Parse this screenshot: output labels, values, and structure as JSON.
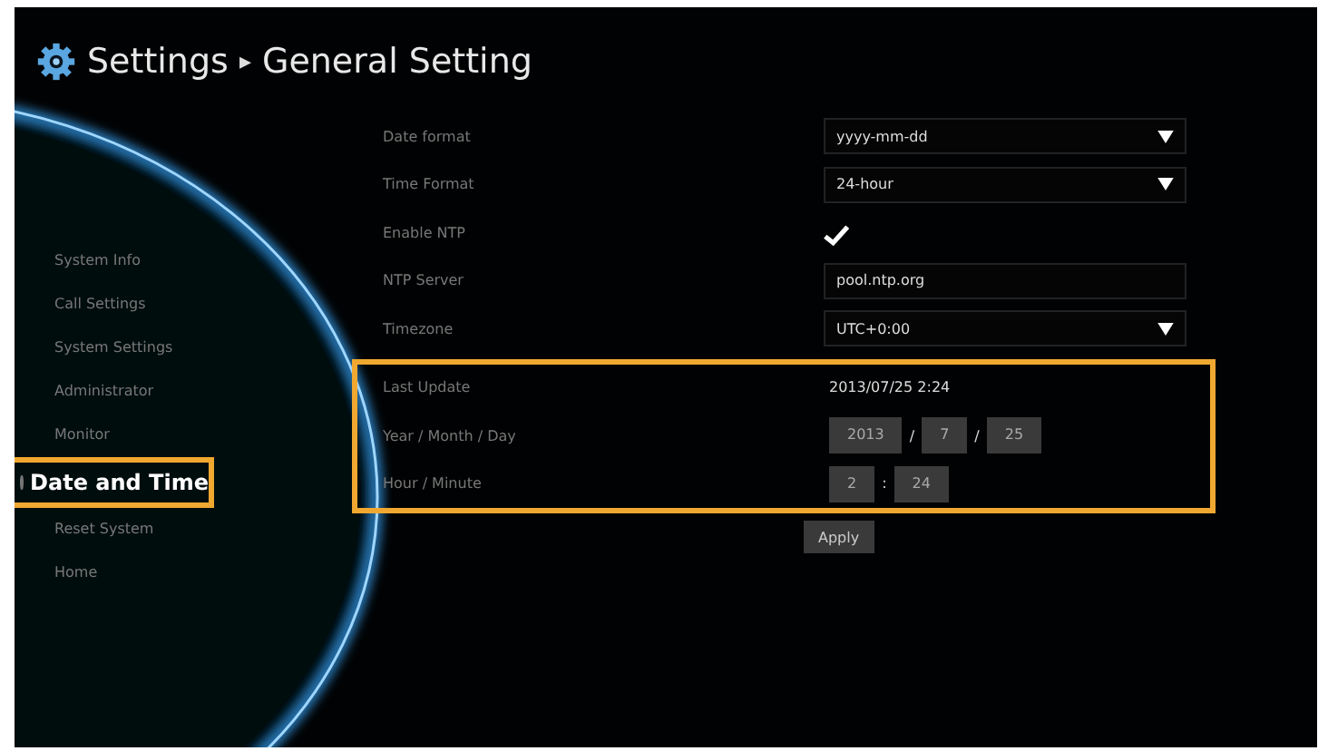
{
  "header": {
    "title": "Settings",
    "separator": "▸",
    "subtitle": "General Setting"
  },
  "sidebar": {
    "items": [
      {
        "label": "System Info",
        "selected": false
      },
      {
        "label": "Call Settings",
        "selected": false
      },
      {
        "label": "System Settings",
        "selected": false
      },
      {
        "label": "Administrator",
        "selected": false
      },
      {
        "label": "Monitor",
        "selected": false
      },
      {
        "label": "Date and Time",
        "selected": true
      },
      {
        "label": "Reset System",
        "selected": false
      },
      {
        "label": "Home",
        "selected": false
      }
    ]
  },
  "groups": [
    {
      "rows": [
        {
          "kind": "select",
          "label": "Date format",
          "value": "yyyy-mm-dd"
        },
        {
          "kind": "select",
          "label": "Time Format",
          "value": "24-hour"
        },
        {
          "kind": "checkbox",
          "label": "Enable NTP",
          "checked": true
        },
        {
          "kind": "text",
          "label": "NTP Server",
          "value": "pool.ntp.org"
        },
        {
          "kind": "select",
          "label": "Timezone",
          "value": "UTC+0:00"
        }
      ]
    },
    {
      "highlighted": true,
      "rows": [
        {
          "kind": "display",
          "label": "Last Update",
          "value": "2013/07/25 2:24"
        },
        {
          "kind": "multi",
          "label": "Year / Month / Day",
          "disabled": true,
          "fields": [
            {
              "value": "2013",
              "separator": "/"
            },
            {
              "value": "7",
              "separator": "/"
            },
            {
              "value": "25"
            }
          ]
        },
        {
          "kind": "multi",
          "label": "Hour / Minute",
          "disabled": true,
          "fields": [
            {
              "value": "2",
              "separator": ":"
            },
            {
              "value": "24"
            }
          ]
        }
      ]
    }
  ],
  "apply_button": "Apply"
}
